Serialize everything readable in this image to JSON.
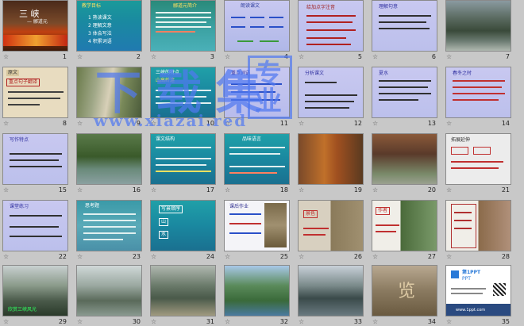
{
  "slides": [
    {
      "n": "1",
      "title": "三 峡",
      "sub": "— 郦道元"
    },
    {
      "n": "2",
      "lines": [
        "教学目标",
        "1 熟读课文",
        "2 理解文意",
        "3 体会写法",
        "4 积累词语"
      ]
    },
    {
      "n": "3",
      "title": "郦道元简介"
    },
    {
      "n": "4",
      "title": "朗读课文"
    },
    {
      "n": "5",
      "lines": [
        "给加点字注音"
      ]
    },
    {
      "n": "6",
      "lines": [
        "理解句意"
      ]
    },
    {
      "n": "7"
    },
    {
      "n": "8",
      "lines": [
        "原文",
        "重点句子翻译"
      ]
    },
    {
      "n": "9"
    },
    {
      "n": "10",
      "lines": [
        "三峡的特点",
        "山高岭连"
      ]
    },
    {
      "n": "11",
      "lines": [
        "重点词语"
      ]
    },
    {
      "n": "12",
      "lines": [
        "分析课文"
      ]
    },
    {
      "n": "13",
      "lines": [
        "夏水"
      ]
    },
    {
      "n": "14",
      "lines": [
        "春冬之时"
      ]
    },
    {
      "n": "15",
      "lines": [
        "写作特点"
      ]
    },
    {
      "n": "16"
    },
    {
      "n": "17",
      "lines": [
        "课文结构"
      ]
    },
    {
      "n": "18",
      "lines": [
        "品味语言"
      ]
    },
    {
      "n": "19"
    },
    {
      "n": "20"
    },
    {
      "n": "21",
      "lines": [
        "拓展延伸"
      ]
    },
    {
      "n": "22",
      "lines": [
        "课堂练习"
      ]
    },
    {
      "n": "23",
      "lines": [
        "思考题"
      ]
    },
    {
      "n": "24",
      "lines": [
        "写景顺序",
        "山",
        "水"
      ]
    },
    {
      "n": "25",
      "lines": [
        "课后作业"
      ]
    },
    {
      "n": "26",
      "lines": [
        "景色"
      ]
    },
    {
      "n": "27",
      "lines": [
        "作者"
      ]
    },
    {
      "n": "28"
    },
    {
      "n": "29",
      "lines": [
        "欣赏三峡风光"
      ]
    },
    {
      "n": "30"
    },
    {
      "n": "31"
    },
    {
      "n": "32"
    },
    {
      "n": "33"
    },
    {
      "n": "34",
      "lines": [
        "览"
      ]
    },
    {
      "n": "35",
      "lines": [
        "第1PPT",
        "PPT",
        "www.1ppt.com"
      ]
    }
  ],
  "watermark": {
    "main": "下载集",
    "side": "专业",
    "url": "www.xiazai.red"
  },
  "star_glyph": "☆"
}
